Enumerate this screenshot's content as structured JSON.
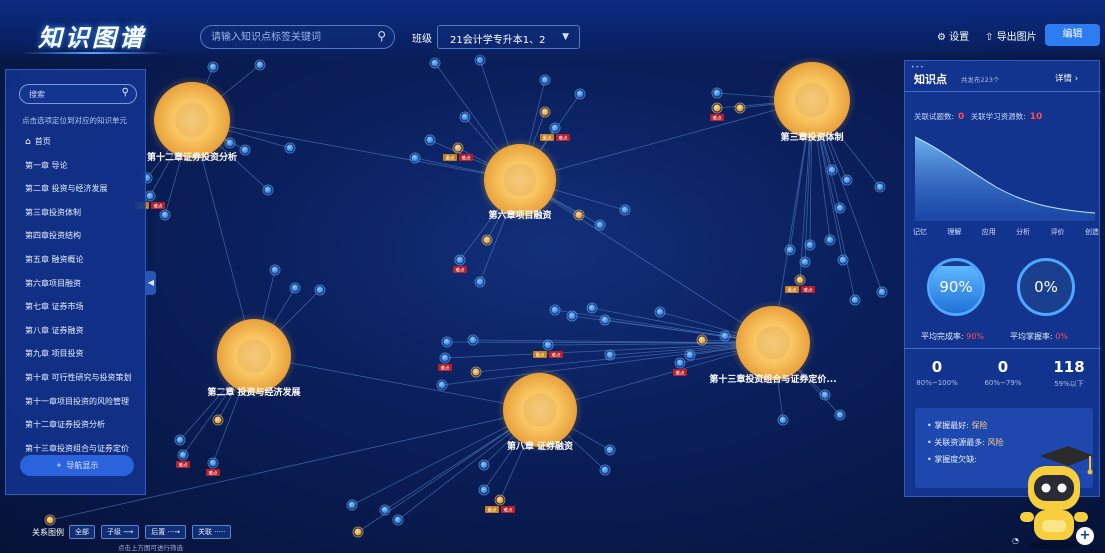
{
  "header": {
    "logo": "知识图谱",
    "search_placeholder": "请输入知识点标签关键词",
    "class_label": "班级",
    "class_value": "21会计学专升本1、2",
    "settings_label": "设置",
    "export_label": "导出图片",
    "edit_label": "编辑"
  },
  "sidebar": {
    "search_placeholder": "搜索",
    "hint": "点击选项定位到对应的知识单元",
    "items": [
      {
        "label": "首页"
      },
      {
        "label": "第一章 导论"
      },
      {
        "label": "第二章 投资与经济发展"
      },
      {
        "label": "第三章投资体制"
      },
      {
        "label": "第四章投资结构"
      },
      {
        "label": "第五章 融资概论"
      },
      {
        "label": "第六章项目融资"
      },
      {
        "label": "第七章 证券市场"
      },
      {
        "label": "第八章 证券融资"
      },
      {
        "label": "第九章 项目投资"
      },
      {
        "label": "第十章 可行性研究与投资策划"
      },
      {
        "label": "第十一章项目投资的风险管理"
      },
      {
        "label": "第十二章证券投资分析"
      },
      {
        "label": "第十三章投资组合与证券定价"
      }
    ],
    "nav_button": "导航显示"
  },
  "graph": {
    "chapters": [
      {
        "label": "第十二章证券投资分析"
      },
      {
        "label": "第六章项目融资"
      },
      {
        "label": "第三章投资体制"
      },
      {
        "label": "第二章 投资与经济发展"
      },
      {
        "label": "第十三章投资组合与证券定价..."
      },
      {
        "label": "第八章 证券融资"
      }
    ],
    "tag_key": "重点",
    "tag_hard": "难点"
  },
  "right_panel": {
    "title": "知识点",
    "subtitle": "共发布223个",
    "detail_label": "详情",
    "stats": {
      "related_questions_label": "关联试题数:",
      "related_questions": "0",
      "related_resources_label": "关联学习资源数:",
      "related_resources": "10"
    },
    "curve_axis": [
      "记忆",
      "理解",
      "应用",
      "分析",
      "评价",
      "创造"
    ],
    "gauges": [
      {
        "value": "90%",
        "fraction": 0.9,
        "caption": "平均完成率:",
        "caption_value": "90%"
      },
      {
        "value": "0%",
        "fraction": 0.0,
        "caption": "平均掌握率:",
        "caption_value": "0%"
      }
    ],
    "counts": [
      {
        "value": "0",
        "range": "80%~100%"
      },
      {
        "value": "0",
        "range": "60%~79%"
      },
      {
        "value": "118",
        "range": "59%以下"
      }
    ],
    "summary": [
      {
        "label": "掌握最好:",
        "value": "保险"
      },
      {
        "label": "关联资源最多:",
        "value": "风险"
      },
      {
        "label": "掌握度欠缺:",
        "value": ""
      }
    ]
  },
  "legend": {
    "title": "关系图例",
    "all_label": "全部",
    "child": "子级",
    "after": "后置",
    "related": "关联",
    "hint": "点击上方图可进行筛选"
  },
  "colors": {
    "accent": "#2d7cf0",
    "node_orange": "#f2b43a",
    "node_blue": "#3f8cf0",
    "highlight_red": "#ff4d4d"
  }
}
